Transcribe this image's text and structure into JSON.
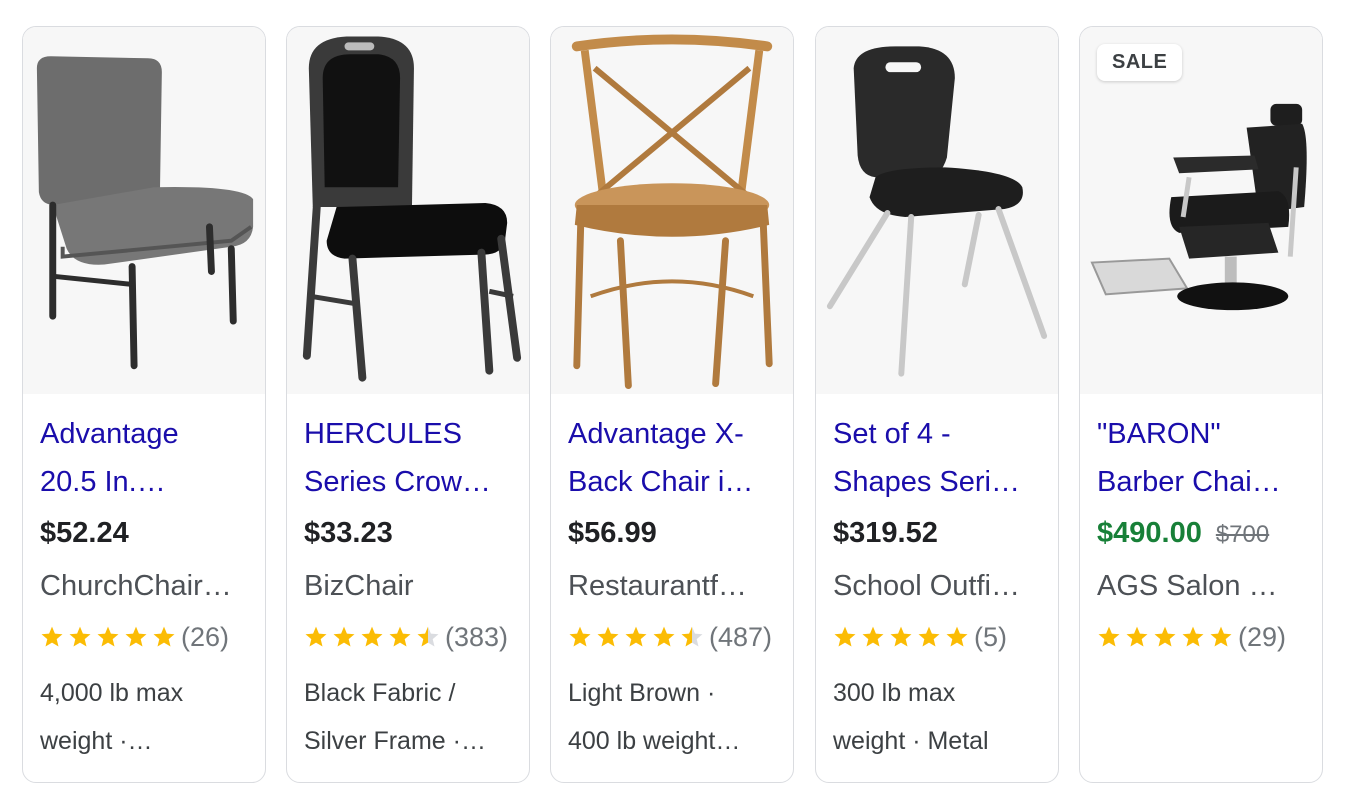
{
  "products": [
    {
      "title_line1": "Advantage",
      "title_line2": "20.5 In.…",
      "price": "$52.24",
      "seller": "ChurchChair…",
      "stars": 5,
      "rating_count": "(26)",
      "detail_line1": "4,000 lb max",
      "detail_line2": "weight ·…",
      "image_icon": "gray-fabric-stacking-chair"
    },
    {
      "title_line1": "HERCULES",
      "title_line2": "Series Crow…",
      "price": "$33.23",
      "seller": "BizChair",
      "stars": 4.5,
      "rating_count": "(383)",
      "detail_line1": "Black Fabric /",
      "detail_line2": "Silver Frame ·…",
      "image_icon": "black-banquet-chair"
    },
    {
      "title_line1": "Advantage X-",
      "title_line2": "Back Chair i…",
      "price": "$56.99",
      "seller": "Restaurantf…",
      "stars": 4.5,
      "rating_count": "(487)",
      "detail_line1": "Light Brown ·",
      "detail_line2": "400 lb weight…",
      "image_icon": "wooden-x-back-chair"
    },
    {
      "title_line1": "Set of 4 -",
      "title_line2": "Shapes Seri…",
      "price": "$319.52",
      "seller": "School Outfi…",
      "stars": 5,
      "rating_count": "(5)",
      "detail_line1": "300 lb max",
      "detail_line2": "weight · Metal",
      "image_icon": "black-shell-school-chair"
    },
    {
      "badge": "SALE",
      "title_line1": "\"BARON\"",
      "title_line2": "Barber Chai…",
      "price": "$490.00",
      "original_price": "$700",
      "seller": "AGS Salon …",
      "stars": 5,
      "rating_count": "(29)",
      "image_icon": "black-barber-chair"
    }
  ],
  "colors": {
    "title_link": "#1a0dab",
    "price": "#202124",
    "sale_price": "#188038",
    "star_filled": "#fbbc04",
    "star_empty": "#dadce0"
  }
}
